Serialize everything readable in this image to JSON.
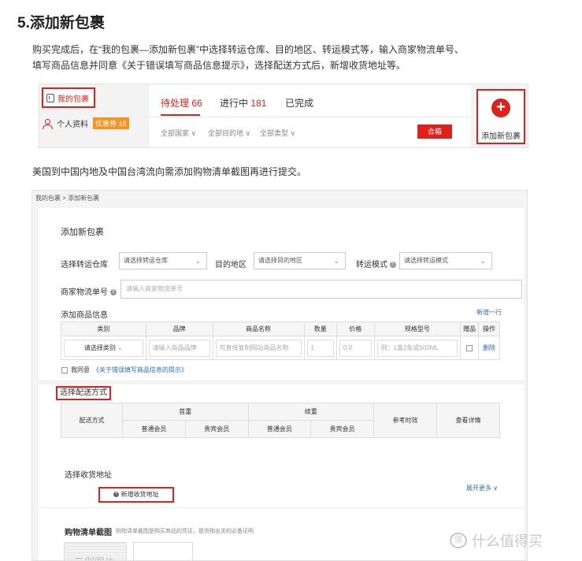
{
  "heading": "5.添加新包裹",
  "para1_line1": "购买完成后，在“我的包裹—添加新包裹”中选择转运仓库、目的地区、转运模式等，输入商家物流单号、",
  "para1_line2": "填写商品信息并同意《关于错误填写商品信息提示》，选择配送方式后，新增收货地址等。",
  "para2": "美国到中国内地及中国台湾流向需添加购物清单截图再进行提交。",
  "shot1": {
    "my_package": "我的包裹",
    "profile": "个人资料",
    "coupon": "优惠券 18",
    "tabs": [
      {
        "label": "待处理",
        "count": "66"
      },
      {
        "label": "进行中",
        "count": "181"
      },
      {
        "label": "已完成",
        "count": ""
      }
    ],
    "filters": [
      "全部国家 ∨",
      "全部目的地 ∨",
      "全部类型 ∨"
    ],
    "merge_button": "合箱",
    "add_package": "添加新包裹",
    "add_icon": "plus-icon"
  },
  "shot2": {
    "breadcrumb": "我的包裹  >  添加新包裹",
    "title": "添加新包裹",
    "warehouse_label": "选择转运仓库",
    "warehouse_placeholder": "请选择转运仓库",
    "destination_label": "目的地区",
    "destination_placeholder": "请选择目的地区",
    "mode_label": "转运模式",
    "mode_placeholder": "请选择转运模式",
    "tracking_label": "商家物流单号",
    "tracking_placeholder": "请输入商家物流单号",
    "goods_label": "添加商品信息",
    "add_row": "新增一行",
    "goods_headers": [
      "类别",
      "品牌",
      "商品名称",
      "数量",
      "价格",
      "规格型号",
      "赠品",
      "操作"
    ],
    "goods_row": {
      "category": "请选择类别",
      "brand": "请输入商品品牌",
      "name": "可直接复制网站商品名称",
      "qty": "1",
      "price": "0.0",
      "spec": "例：1盒2条或500ML",
      "delete": "删除"
    },
    "agree_text": "我同意",
    "agree_link": "《关于错误填写商品信息的提示》",
    "shipping_title": "选择配送方式",
    "ship_headers": {
      "method": "配送方式",
      "first": "首重",
      "extra": "续重",
      "time": "参考时效",
      "detail": "查看详情",
      "normal": "普通会员",
      "vip": "贵宾会员"
    },
    "address_title": "选择收货地址",
    "add_address": "新增收货地址",
    "expand_more": "展开更多 ∨",
    "shopping_title": "购物清单截图",
    "shopping_hint": "购物清单截图是购买商品的凭证，是货物出关的必备证明",
    "thumb_watermark": "示例图片"
  },
  "watermark": "什么值得买",
  "watermark_logo": "值"
}
